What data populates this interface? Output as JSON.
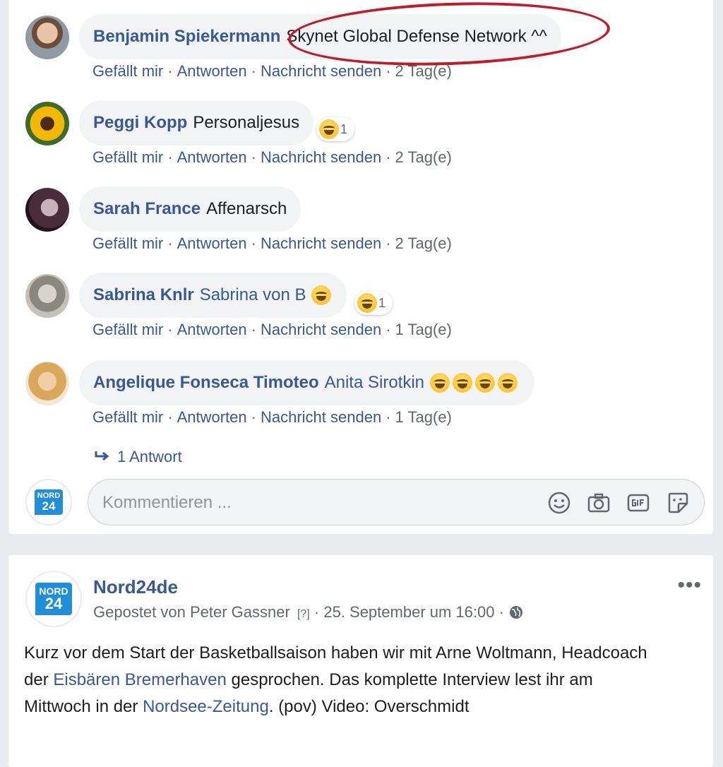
{
  "action_labels": {
    "like": "Gefällt mir",
    "reply": "Antworten",
    "message": "Nachricht senden",
    "sep": "·"
  },
  "comments": [
    {
      "author": "Benjamin Spiekermann",
      "text": "Skynet Global Defense Network ^^",
      "time": "2 Tag(e)"
    },
    {
      "author": "Peggi Kopp",
      "text": "Personaljesus",
      "time": "2 Tag(e)",
      "reaction_count": "1"
    },
    {
      "author": "Sarah France",
      "text": "Affenarsch",
      "time": "2 Tag(e)"
    },
    {
      "author": "Sabrina Knlr",
      "text": "Sabrina von B",
      "time": "1 Tag(e)",
      "reaction_count": "1"
    },
    {
      "author": "Angelique Fonseca Timoteo",
      "text": "Anita Sirotkin",
      "time": "1 Tag(e)"
    }
  ],
  "replies_link": "1 Antwort",
  "composer": {
    "placeholder": "Kommentieren ..."
  },
  "logo": {
    "line1": "NORD",
    "line2": "24"
  },
  "post": {
    "page_name": "Nord24de",
    "posted_by": "Gepostet von Peter Gassner",
    "help_marker": "[?]",
    "date": "25. September um 16:00",
    "more_label": "•••",
    "body_1": "Kurz vor dem Start der Basketballsaison haben wir mit Arne Woltmann, Headcoach der ",
    "body_link1": "Eisbären Bremerhaven",
    "body_2": " gesprochen. Das komplette Interview lest ihr am Mittwoch in der ",
    "body_link2": "Nordsee-Zeitung",
    "body_3": ". (pov) Video: Overschmidt"
  },
  "colors": {
    "link": "#385898",
    "annotation_circle": "#c11a2a",
    "logo_blue": "#1e8fd8"
  }
}
